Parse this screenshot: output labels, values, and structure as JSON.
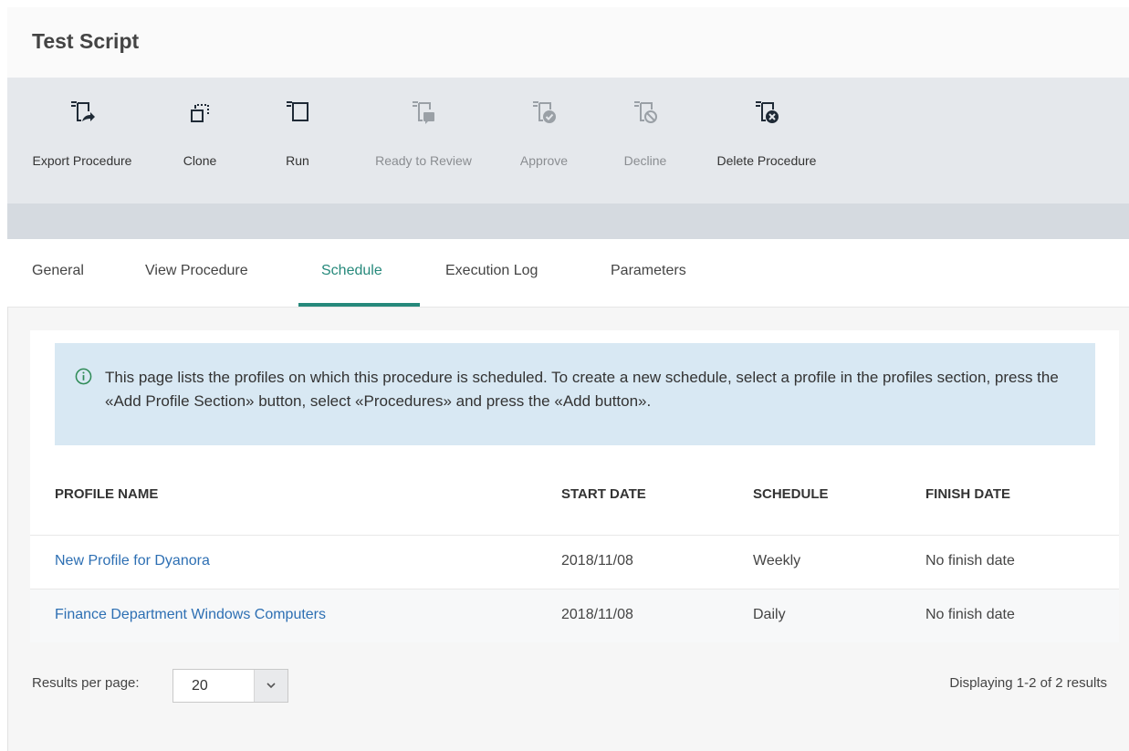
{
  "page": {
    "title": "Test Script"
  },
  "toolbar": {
    "buttons": [
      {
        "label": "Export Procedure",
        "icon": "export-procedure-icon",
        "enabled": true
      },
      {
        "label": "Clone",
        "icon": "clone-icon",
        "enabled": true
      },
      {
        "label": "Run",
        "icon": "run-icon",
        "enabled": true
      },
      {
        "label": "Ready to Review",
        "icon": "ready-to-review-icon",
        "enabled": false
      },
      {
        "label": "Approve",
        "icon": "approve-icon",
        "enabled": false
      },
      {
        "label": "Decline",
        "icon": "decline-icon",
        "enabled": false
      },
      {
        "label": "Delete Procedure",
        "icon": "delete-procedure-icon",
        "enabled": true
      }
    ]
  },
  "tabs": [
    {
      "label": "General",
      "active": false
    },
    {
      "label": "View Procedure",
      "active": false
    },
    {
      "label": "Schedule",
      "active": true
    },
    {
      "label": "Execution Log",
      "active": false
    },
    {
      "label": "Parameters",
      "active": false
    }
  ],
  "notice": {
    "icon": "info-icon",
    "text": "This page lists the profiles on which this procedure is scheduled. To create a new schedule, select a profile in the profiles section, press the «Add Profile Section» button, select «Procedures» and press the «Add button»."
  },
  "table": {
    "columns": [
      "PROFILE NAME",
      "START DATE",
      "SCHEDULE",
      "FINISH DATE"
    ],
    "rows": [
      {
        "profile_name": "New Profile for Dyanora",
        "start_date": "2018/11/08",
        "schedule": "Weekly",
        "finish_date": "No finish date"
      },
      {
        "profile_name": "Finance Department Windows Computers",
        "start_date": "2018/11/08",
        "schedule": "Daily",
        "finish_date": "No finish date"
      }
    ]
  },
  "pagination": {
    "results_per_page_label": "Results per page:",
    "results_per_page_value": "20",
    "summary": "Displaying 1-2 of 2 results"
  },
  "colors": {
    "accent": "#26897b",
    "link": "#2d6fb3",
    "notice_bg": "#d8e8f3",
    "toolbar_bg": "#e5e8ec",
    "disabled_icon": "#9aa0a6"
  }
}
